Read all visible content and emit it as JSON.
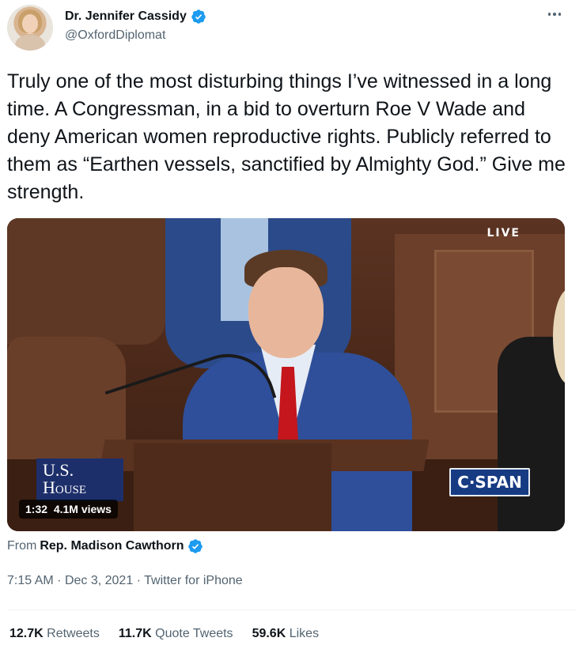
{
  "author": {
    "display_name": "Dr. Jennifer Cassidy",
    "handle": "@OxfordDiplomat",
    "verified": true
  },
  "tweet": {
    "text": "Truly one of the most disturbing things I’ve witnessed in a long time. A Congressman, in a bid to overturn Roe V Wade and deny American women reproductive rights. Publicly referred to them as “Earthen vessels, sanctified by Almighty God.” Give me strength."
  },
  "media": {
    "live_label": "LIVE",
    "house_logo_line1": "U.S.",
    "house_logo_line2": "House",
    "channel_logo": "C·SPAN",
    "duration": "1:32",
    "views": "4.1M views"
  },
  "attribution": {
    "prefix": "From",
    "source_name": "Rep. Madison Cawthorn",
    "verified": true
  },
  "meta": {
    "time": "7:15 AM",
    "date": "Dec 3, 2021",
    "client": "Twitter for iPhone",
    "separator": "·"
  },
  "stats": {
    "retweets_count": "12.7K",
    "retweets_label": "Retweets",
    "quotes_count": "11.7K",
    "quotes_label": "Quote Tweets",
    "likes_count": "59.6K",
    "likes_label": "Likes"
  },
  "colors": {
    "text_primary": "#0f1419",
    "text_secondary": "#536471",
    "verified_blue": "#1d9bf0"
  }
}
